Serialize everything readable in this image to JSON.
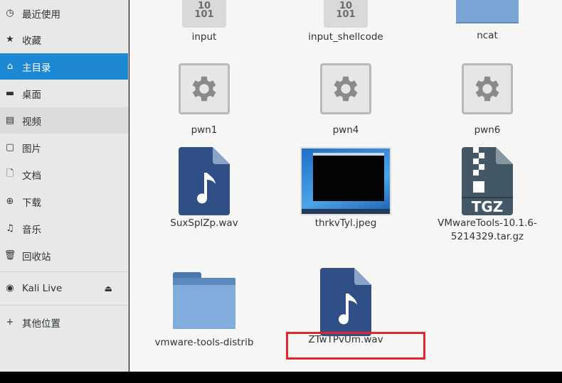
{
  "sidebar": {
    "items": [
      {
        "label": "最近使用",
        "icon": "clock-icon"
      },
      {
        "label": "收藏",
        "icon": "star-icon"
      },
      {
        "label": "主目录",
        "icon": "home-icon",
        "selected": true
      },
      {
        "label": "桌面",
        "icon": "folder-icon"
      },
      {
        "label": "视频",
        "icon": "film-icon"
      },
      {
        "label": "图片",
        "icon": "image-icon"
      },
      {
        "label": "文档",
        "icon": "document-icon"
      },
      {
        "label": "下载",
        "icon": "download-icon"
      },
      {
        "label": "音乐",
        "icon": "music-icon"
      },
      {
        "label": "回收站",
        "icon": "trash-icon"
      }
    ],
    "device": {
      "label": "Kali Live",
      "icon": "disc-icon",
      "action": "eject-icon"
    },
    "other": {
      "label": "其他位置",
      "icon": "plus-icon"
    }
  },
  "files": [
    {
      "name": "input",
      "type": "binary"
    },
    {
      "name": "input_shellcode",
      "type": "binary"
    },
    {
      "name": "ncat",
      "type": "folder"
    },
    {
      "name": "pwn1",
      "type": "executable"
    },
    {
      "name": "pwn4",
      "type": "executable"
    },
    {
      "name": "pwn6",
      "type": "executable"
    },
    {
      "name": "SuxSplZp.wav",
      "type": "audio"
    },
    {
      "name": "thrkvTyl.jpeg",
      "type": "image"
    },
    {
      "name": "VMwareTools-10.1.6-5214329.tar.gz",
      "type": "archive",
      "badge": "TGZ"
    },
    {
      "name": "vmware-tools-distrib",
      "type": "folder"
    },
    {
      "name": "ZTwTPvUm.wav",
      "type": "audio",
      "highlighted": true
    }
  ],
  "binary_glyph": "10\n101",
  "colors": {
    "accent": "#1c88d4",
    "highlight_box": "#e3262e",
    "audio_icon": "#2f4f86"
  }
}
